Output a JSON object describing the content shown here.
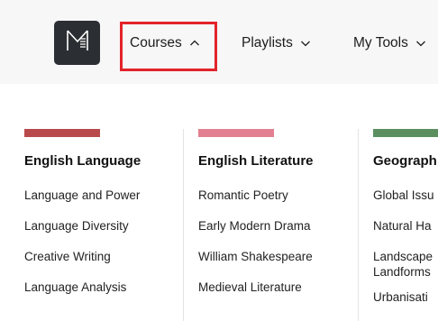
{
  "nav": {
    "logo_icon": "m-logo-icon",
    "items": [
      {
        "label": "Courses",
        "icon": "chevron-up-icon",
        "expanded": true
      },
      {
        "label": "Playlists",
        "icon": "chevron-down-icon",
        "expanded": false
      },
      {
        "label": "My Tools",
        "icon": "chevron-down-icon",
        "expanded": false
      }
    ],
    "highlight_color": "#e2232a"
  },
  "dropdown": {
    "columns": [
      {
        "title": "English Language",
        "color": "#b94a4c",
        "links": [
          "Language and Power",
          "Language Diversity",
          "Creative Writing",
          "Language Analysis"
        ]
      },
      {
        "title": "English Literature",
        "color": "#e28091",
        "links": [
          "Romantic Poetry",
          "Early Modern Drama",
          "William Shakespeare",
          "Medieval Literature"
        ]
      },
      {
        "title": "Geograph",
        "color": "#5c8f5f",
        "links": [
          "Global Issu",
          "Natural Ha",
          "Landscape Landforms",
          "Urbanisati"
        ]
      }
    ]
  }
}
